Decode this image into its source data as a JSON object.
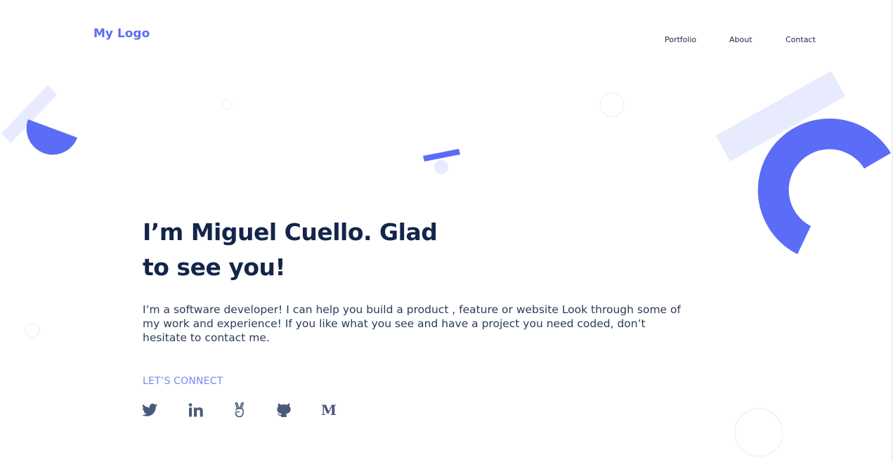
{
  "header": {
    "logo": "My Logo",
    "nav": [
      {
        "label": "Portfolio"
      },
      {
        "label": "About"
      },
      {
        "label": "Contact"
      }
    ]
  },
  "hero": {
    "title_line1": "I’m Miguel Cuello. Glad",
    "title_line2": "to see you!",
    "description": "I’m a software developer! I can help you build a product , feature or website Look through some of my work and experience! If you like what you see and have a project you need coded, don’t hesitate to contact me.",
    "connect_label": "LET’S CONNECT"
  },
  "social": [
    {
      "icon": "twitter-icon"
    },
    {
      "icon": "linkedin-icon"
    },
    {
      "icon": "angellist-icon"
    },
    {
      "icon": "github-icon"
    },
    {
      "icon": "medium-icon"
    }
  ],
  "colors": {
    "accent": "#5b6cf6",
    "accent_light": "#e8eafd",
    "heading": "#14254a",
    "text": "#2b3a5a",
    "connect": "#7b86f0",
    "icon": "#4a5a7a"
  }
}
